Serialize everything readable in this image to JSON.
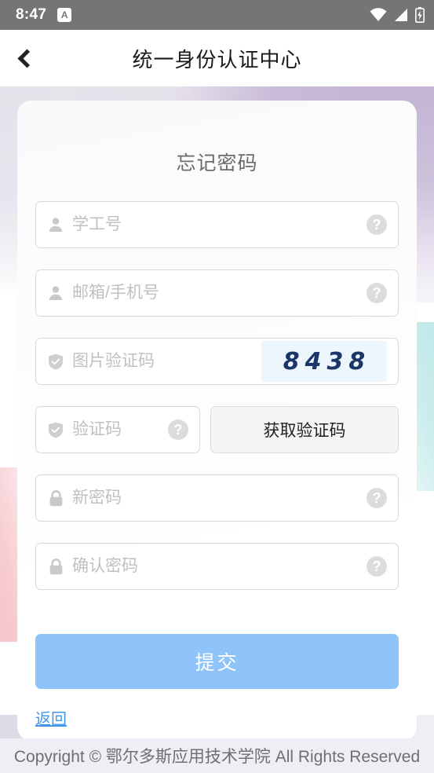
{
  "status_bar": {
    "time": "8:47",
    "notification_icon": "app-letter-a-icon",
    "notification_letter": "A",
    "icons": [
      "wifi-icon",
      "cellular-signal-icon",
      "battery-charging-icon"
    ]
  },
  "title_bar": {
    "back_icon": "back-chevron-icon",
    "title": "统一身份认证中心"
  },
  "form": {
    "heading": "忘记密码",
    "fields": [
      {
        "name": "student-staff-id",
        "icon": "user-icon",
        "placeholder": "学工号",
        "value": "",
        "help_icon": "help-question-icon",
        "help_label": "?"
      },
      {
        "name": "email-or-phone",
        "icon": "user-icon",
        "placeholder": "邮箱/手机号",
        "value": "",
        "help_icon": "help-question-icon",
        "help_label": "?"
      },
      {
        "name": "image-captcha",
        "icon": "shield-check-icon",
        "placeholder": "图片验证码",
        "value": "",
        "captcha_text": "8438",
        "captcha_bg": "#edf6fc",
        "captcha_color": "#1b3568"
      },
      {
        "name": "sms-code",
        "icon": "shield-check-icon",
        "placeholder": "验证码",
        "value": "",
        "help_icon": "help-question-icon",
        "help_label": "?"
      },
      {
        "name": "new-password",
        "icon": "lock-icon",
        "placeholder": "新密码",
        "value": "",
        "help_icon": "help-question-icon",
        "help_label": "?"
      },
      {
        "name": "confirm-password",
        "icon": "lock-icon",
        "placeholder": "确认密码",
        "value": "",
        "help_icon": "help-question-icon",
        "help_label": "?"
      }
    ],
    "get_code_button": "获取验证码",
    "submit_button": "提交",
    "back_link": "返回"
  },
  "footer": {
    "copyright": "Copyright © 鄂尔多斯应用技术学院 All Rights Reserved"
  },
  "colors": {
    "status_bar_bg": "#757575",
    "submit_bg": "#8fc4f8",
    "link_color": "#4096ee",
    "accent_purple": "#c3b4d4",
    "accent_cyan": "#bfe8e8",
    "accent_pink": "#f6c4cb"
  }
}
